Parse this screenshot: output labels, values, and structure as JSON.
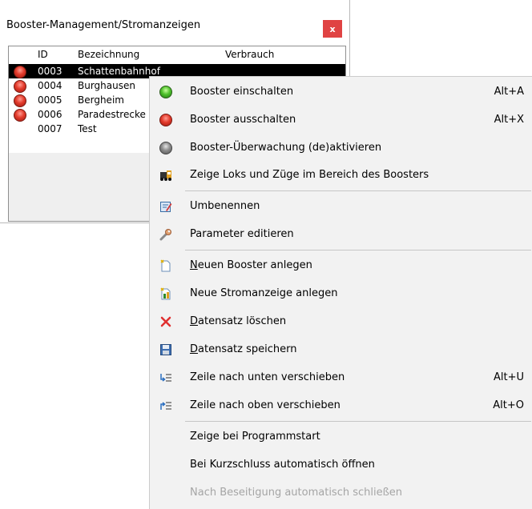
{
  "window": {
    "title": "Booster-Management/Stromanzeigen",
    "close_label": "x"
  },
  "list": {
    "headers": {
      "id": "ID",
      "name": "Bezeichnung",
      "usage": "Verbrauch"
    },
    "rows": [
      {
        "id": "0003",
        "name": "Schattenbahnhof",
        "led": "red",
        "selected": true
      },
      {
        "id": "0004",
        "name": "Burghausen",
        "led": "red",
        "selected": false
      },
      {
        "id": "0005",
        "name": "Bergheim",
        "led": "red",
        "selected": false
      },
      {
        "id": "0006",
        "name": "Paradestrecke",
        "led": "red",
        "selected": false
      },
      {
        "id": "0007",
        "name": "Test",
        "led": "none",
        "selected": false
      }
    ]
  },
  "menu": {
    "items": [
      {
        "label": "Booster einschalten",
        "shortcut": "Alt+A",
        "icon": "green-light-icon"
      },
      {
        "label": "Booster ausschalten",
        "shortcut": "Alt+X",
        "icon": "red-light-icon"
      },
      {
        "label": "Booster-Überwachung (de)aktivieren",
        "shortcut": "",
        "icon": "gray-light-icon"
      },
      {
        "label": "Zeige Loks und Züge im Bereich des Boosters",
        "shortcut": "",
        "icon": "locomotive-icon"
      },
      {
        "label": "Umbenennen",
        "shortcut": "",
        "icon": "rename-icon"
      },
      {
        "label": "Parameter editieren",
        "shortcut": "",
        "icon": "wrench-icon"
      },
      {
        "label_underline": "N",
        "label_rest": "euen Booster anlegen",
        "shortcut": "",
        "icon": "new-document-icon"
      },
      {
        "label": "Neue Stromanzeige anlegen",
        "shortcut": "",
        "icon": "new-meter-icon"
      },
      {
        "label_underline": "D",
        "label_rest": "atensatz löschen",
        "shortcut": "",
        "icon": "delete-icon"
      },
      {
        "label_underline": "D",
        "label_rest": "atensatz speichern",
        "shortcut": "",
        "icon": "save-icon"
      },
      {
        "label": "Zeile nach unten verschieben",
        "shortcut": "Alt+U",
        "icon": "move-down-icon"
      },
      {
        "label": "Zeile nach oben verschieben",
        "shortcut": "Alt+O",
        "icon": "move-up-icon"
      },
      {
        "label": "Zeige bei Programmstart",
        "shortcut": ""
      },
      {
        "label": "Bei Kurzschluss automatisch öffnen",
        "shortcut": ""
      },
      {
        "label": "Nach Beseitigung automatisch schließen",
        "shortcut": "",
        "disabled": true
      }
    ]
  }
}
